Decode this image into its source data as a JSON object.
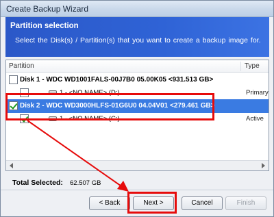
{
  "window": {
    "title": "Create Backup Wizard"
  },
  "banner": {
    "heading": "Partition selection",
    "description": "Select the Disk(s) / Partition(s)  that you want to create a backup image for."
  },
  "list": {
    "columns": {
      "partition": "Partition",
      "type": "Type"
    },
    "disks": [
      {
        "label": "Disk 1 - WDC WD1001FALS-00J7B0 05.00K05  <931.513 GB>",
        "checked": false,
        "selected": false,
        "partitions": [
          {
            "label": "1 - <NO NAME> (D:)",
            "type": "Primary",
            "checked": false
          }
        ]
      },
      {
        "label": "Disk 2 - WDC WD3000HLFS-01G6U0 04.04V01  <279.461 GB>",
        "checked": true,
        "selected": true,
        "partitions": [
          {
            "label": "1 - <NO NAME> (C:)",
            "type": "Active",
            "checked": true
          }
        ]
      }
    ]
  },
  "totals": {
    "label": "Total Selected:",
    "value": "62.507 GB"
  },
  "buttons": {
    "back": "< Back",
    "next": "Next >",
    "cancel": "Cancel",
    "finish": "Finish"
  },
  "colors": {
    "highlight": "#e60b0b",
    "selection": "#3a7be2",
    "banner": "#2f63d6"
  },
  "icons": {
    "drive": "hard-drive-icon",
    "check": "checkmark-icon"
  }
}
